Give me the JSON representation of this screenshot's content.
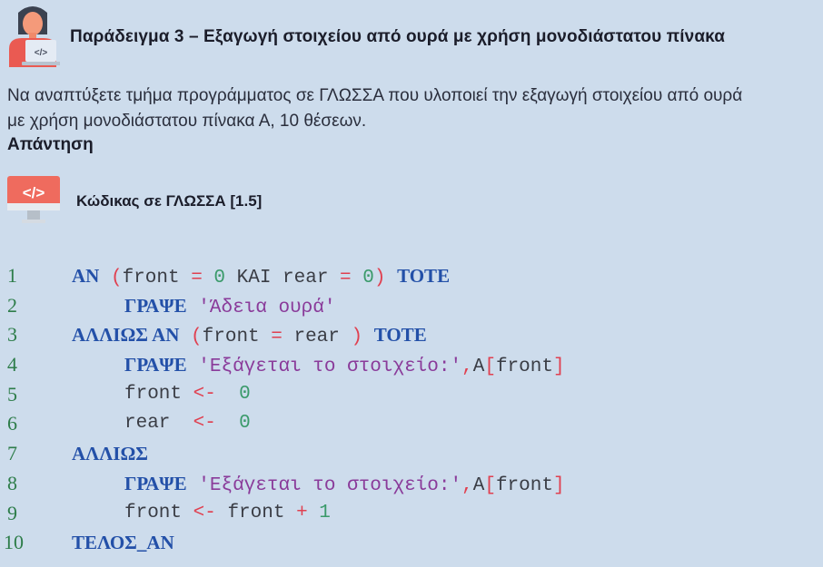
{
  "header": {
    "title": "Παράδειγμα 3 – Εξαγωγή στοιχείου από ουρά με χρήση μονοδιάστατου πίνακα",
    "icon": "student-laptop-icon"
  },
  "body": {
    "paragraph_line1": "Να αναπτύξετε τμήμα προγράμματος σε ΓΛΩΣΣΑ που υλοποιεί την εξαγωγή στοιχείου από ουρά",
    "paragraph_line2": "με χρήση μονοδιάστατου πίνακα Α, 10 θέσεων.",
    "answer_label": "Απάντηση"
  },
  "code_section": {
    "icon": "code-monitor-icon",
    "title": "Κώδικας σε ΓΛΩΣΣΑ [1.5]"
  },
  "colors": {
    "background": "#cddcec",
    "keyword": "#2350a8",
    "string": "#8a3b9a",
    "number": "#3a9a6a",
    "operator": "#e04050",
    "line_number": "#2e7d4a",
    "icon_accent": "#ef6b5e"
  },
  "code_lines": [
    {
      "n": "1",
      "tokens": [
        {
          "t": "kw",
          "v": "ΑΝ"
        },
        {
          "t": "ident",
          "v": " "
        },
        {
          "t": "paren",
          "v": "("
        },
        {
          "t": "ident",
          "v": "front "
        },
        {
          "t": "op",
          "v": "="
        },
        {
          "t": "ident",
          "v": " "
        },
        {
          "t": "num",
          "v": "0"
        },
        {
          "t": "ident",
          "v": " ΚΑΙ rear "
        },
        {
          "t": "op",
          "v": "="
        },
        {
          "t": "ident",
          "v": " "
        },
        {
          "t": "num",
          "v": "0"
        },
        {
          "t": "paren",
          "v": ")"
        },
        {
          "t": "ident",
          "v": " "
        },
        {
          "t": "kw",
          "v": "ΤΟΤΕ"
        }
      ],
      "indent": 0
    },
    {
      "n": "2",
      "tokens": [
        {
          "t": "kw",
          "v": "ΓΡΑΨΕ"
        },
        {
          "t": "ident",
          "v": " "
        },
        {
          "t": "str",
          "v": "'Άδεια ουρά'"
        }
      ],
      "indent": 1
    },
    {
      "n": "3",
      "tokens": [
        {
          "t": "kw",
          "v": "ΑΛΛΙΩΣ ΑΝ"
        },
        {
          "t": "ident",
          "v": " "
        },
        {
          "t": "paren",
          "v": "("
        },
        {
          "t": "ident",
          "v": "front "
        },
        {
          "t": "op",
          "v": "="
        },
        {
          "t": "ident",
          "v": " rear "
        },
        {
          "t": "paren",
          "v": ")"
        },
        {
          "t": "ident",
          "v": " "
        },
        {
          "t": "kw",
          "v": "ΤΟΤΕ"
        }
      ],
      "indent": 0
    },
    {
      "n": "4",
      "tokens": [
        {
          "t": "kw",
          "v": "ΓΡΑΨΕ"
        },
        {
          "t": "ident",
          "v": " "
        },
        {
          "t": "str",
          "v": "'Εξάγεται το στοιχείο:'"
        },
        {
          "t": "op",
          "v": ","
        },
        {
          "t": "ident",
          "v": "A"
        },
        {
          "t": "paren",
          "v": "["
        },
        {
          "t": "ident",
          "v": "front"
        },
        {
          "t": "paren",
          "v": "]"
        }
      ],
      "indent": 1
    },
    {
      "n": "5",
      "tokens": [
        {
          "t": "ident",
          "v": "front "
        },
        {
          "t": "op",
          "v": "<-"
        },
        {
          "t": "ident",
          "v": "  "
        },
        {
          "t": "num",
          "v": "0"
        }
      ],
      "indent": 1
    },
    {
      "n": "6",
      "tokens": [
        {
          "t": "ident",
          "v": "rear  "
        },
        {
          "t": "op",
          "v": "<-"
        },
        {
          "t": "ident",
          "v": "  "
        },
        {
          "t": "num",
          "v": "0"
        }
      ],
      "indent": 1
    },
    {
      "n": "7",
      "tokens": [
        {
          "t": "kw",
          "v": "ΑΛΛΙΩΣ"
        }
      ],
      "indent": 0
    },
    {
      "n": "8",
      "tokens": [
        {
          "t": "kw",
          "v": "ΓΡΑΨΕ"
        },
        {
          "t": "ident",
          "v": " "
        },
        {
          "t": "str",
          "v": "'Εξάγεται το στοιχείο:'"
        },
        {
          "t": "op",
          "v": ","
        },
        {
          "t": "ident",
          "v": "A"
        },
        {
          "t": "paren",
          "v": "["
        },
        {
          "t": "ident",
          "v": "front"
        },
        {
          "t": "paren",
          "v": "]"
        }
      ],
      "indent": 1
    },
    {
      "n": "9",
      "tokens": [
        {
          "t": "ident",
          "v": "front "
        },
        {
          "t": "op",
          "v": "<-"
        },
        {
          "t": "ident",
          "v": " front "
        },
        {
          "t": "op",
          "v": "+"
        },
        {
          "t": "ident",
          "v": " "
        },
        {
          "t": "num",
          "v": "1"
        }
      ],
      "indent": 1
    },
    {
      "n": "10",
      "tokens": [
        {
          "t": "kw",
          "v": "ΤΕΛΟΣ_ΑΝ"
        }
      ],
      "indent": 0
    }
  ]
}
